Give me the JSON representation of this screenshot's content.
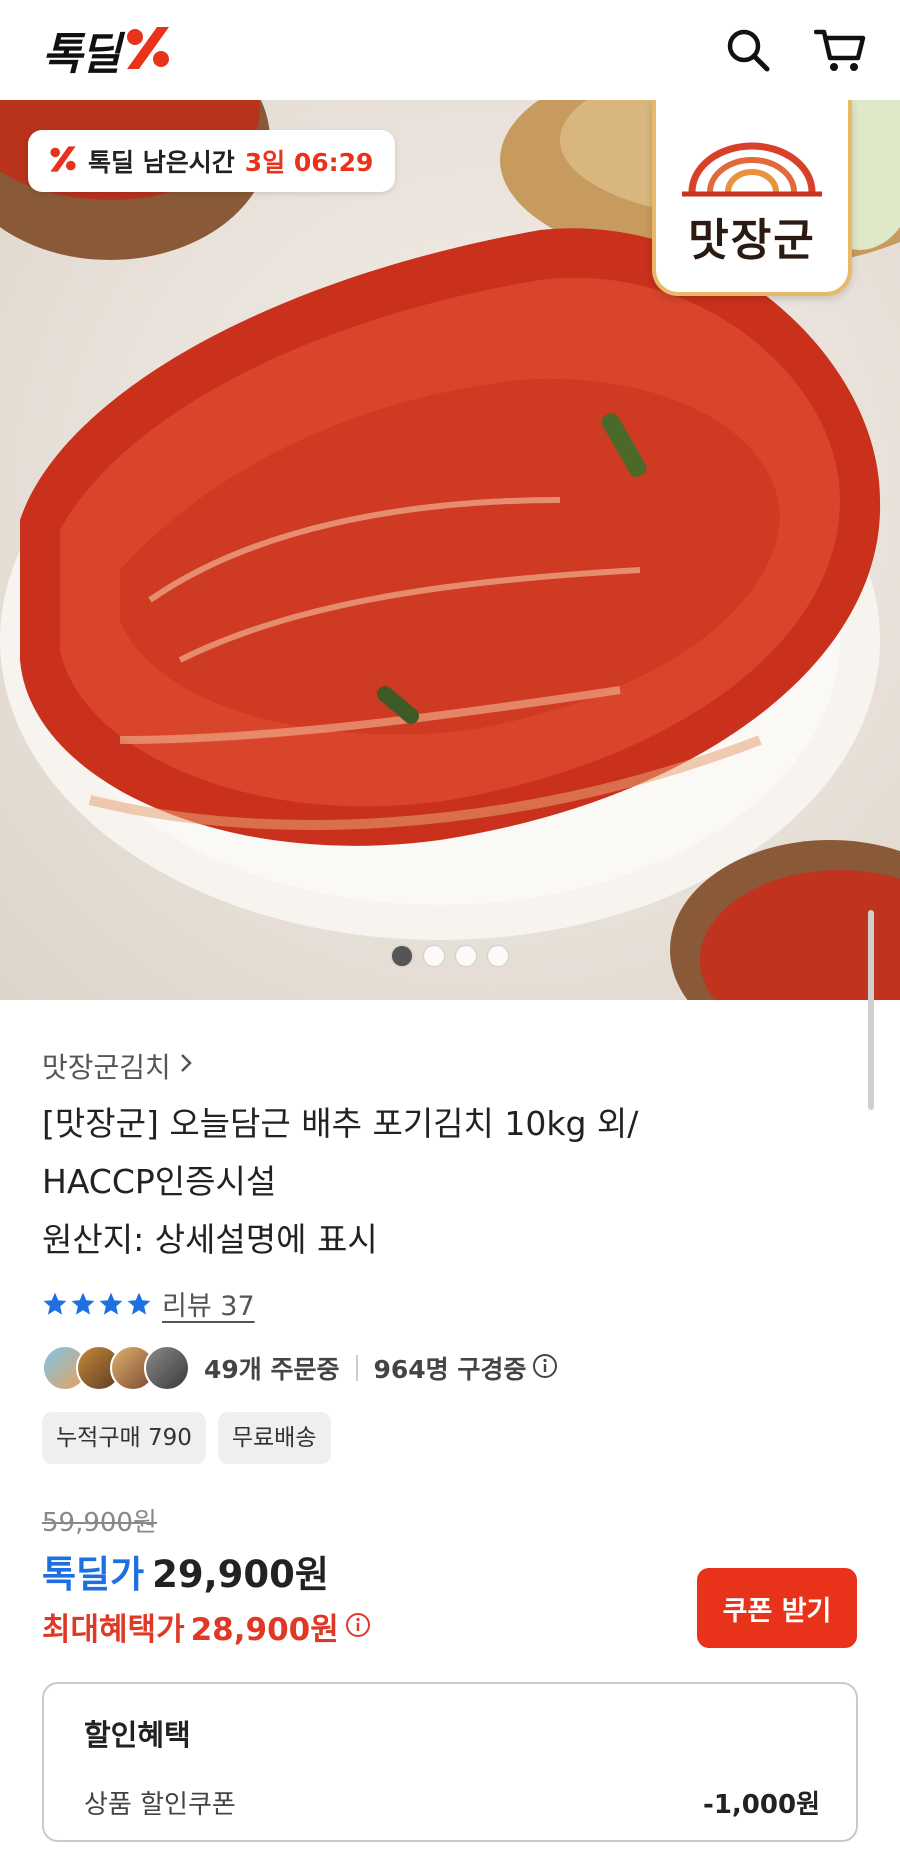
{
  "header": {
    "logo_text": "톡딜",
    "search_icon": "search-icon",
    "cart_icon": "cart-icon"
  },
  "hero": {
    "timer_label": "톡딜 남은시간",
    "timer_value": "3일 06:29",
    "brand_badge": "맛장군",
    "slides_total": 4,
    "slide_active": 1
  },
  "product": {
    "seller": "맛장군김치",
    "title_lines": [
      "[맛장군] 오늘담근 배추 포기김치 10kg 외/",
      "HACCP인증시설",
      "원산지: 상세설명에 표시"
    ],
    "rating_stars": 4,
    "review_label": "리뷰 37",
    "orders": "49개 주문중",
    "viewers": "964명 구경중",
    "chips": [
      "누적구매 790",
      "무료배송"
    ]
  },
  "price": {
    "original": "59,900원",
    "deal_label": "톡딜가",
    "deal_price": "29,900원",
    "max_label": "최대혜택가",
    "max_price": "28,900원",
    "coupon_button": "쿠폰 받기"
  },
  "benefits": {
    "title": "할인혜택",
    "item_name": "상품 할인쿠폰",
    "item_amount": "-1,000원"
  },
  "colors": {
    "accent_red": "#e8321a",
    "deal_blue": "#1e6fe0",
    "star_blue": "#1e6fe0"
  }
}
